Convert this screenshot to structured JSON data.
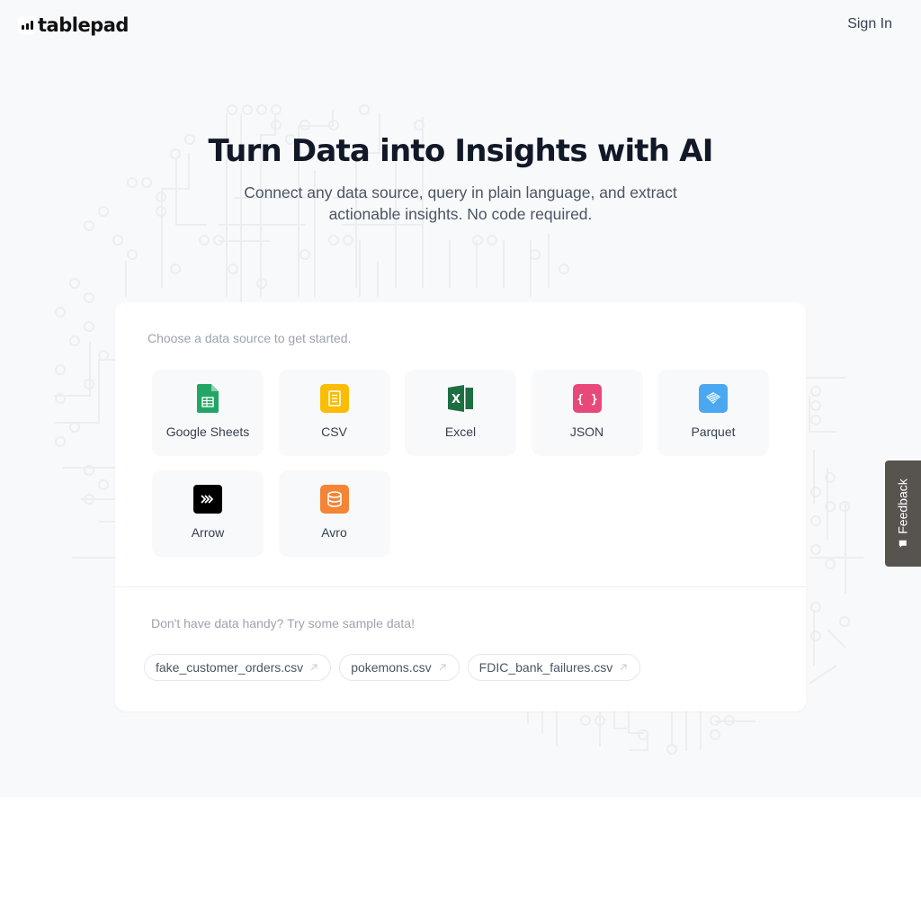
{
  "header": {
    "brand": "tablepad",
    "logo_icon": "bar-chart-icon",
    "sign_in_label": "Sign In"
  },
  "hero": {
    "title": "Turn Data into Insights with AI",
    "subtitle": "Connect any data source, query in plain language, and extract actionable insights. No code required."
  },
  "sources": {
    "prompt": "Choose a data source to get started.",
    "items": [
      {
        "label": "Google Sheets",
        "icon": "google-sheets-icon",
        "color": "#23a566"
      },
      {
        "label": "CSV",
        "icon": "csv-file-icon",
        "color": "#fbbc04"
      },
      {
        "label": "Excel",
        "icon": "excel-icon",
        "color": "#1d6f42"
      },
      {
        "label": "JSON",
        "icon": "json-braces-icon",
        "color": "#e8487a"
      },
      {
        "label": "Parquet",
        "icon": "parquet-icon",
        "color": "#4aa8f0"
      },
      {
        "label": "Arrow",
        "icon": "arrow-chevrons-icon",
        "color": "#000000"
      },
      {
        "label": "Avro",
        "icon": "database-icon",
        "color": "#f58434"
      }
    ]
  },
  "samples": {
    "prompt": "Don't have data handy? Try some sample data!",
    "items": [
      {
        "label": "fake_customer_orders.csv",
        "icon": "external-arrow-icon"
      },
      {
        "label": "pokemons.csv",
        "icon": "external-arrow-icon"
      },
      {
        "label": "FDIC_bank_failures.csv",
        "icon": "external-arrow-icon"
      }
    ]
  },
  "feedback": {
    "label": "Feedback",
    "icon": "feedback-bubble-icon"
  },
  "colors": {
    "page_bg": "#f8f9fb",
    "card_bg": "#ffffff",
    "title": "#111827",
    "muted": "#9ca3af",
    "feedback_bg": "#57534e"
  }
}
